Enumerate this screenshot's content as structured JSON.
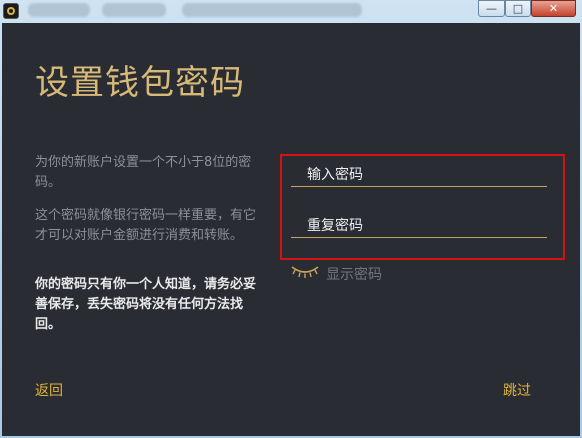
{
  "window": {
    "controls": {
      "minimize": "—",
      "maximize": "□",
      "close": "✕"
    }
  },
  "main": {
    "title": "设置钱包密码",
    "desc1": "为你的新账户设置一个不小于8位的密码。",
    "desc2": "这个密码就像银行密码一样重要，有它才可以对账户金额进行消费和转账。",
    "warning": "你的密码只有你一个人知道，请务必妥善保存，丢失密码将没有任何方法找回。"
  },
  "form": {
    "password_label": "输入密码",
    "repeat_label": "重复密码",
    "show_password": "显示密码",
    "eye_icon": "eye-closed-icon"
  },
  "footer": {
    "back": "返回",
    "skip": "跳过"
  },
  "colors": {
    "accent": "#e1b53b",
    "title": "#d7b978",
    "background": "#2a2c33",
    "highlight": "#d31313"
  }
}
